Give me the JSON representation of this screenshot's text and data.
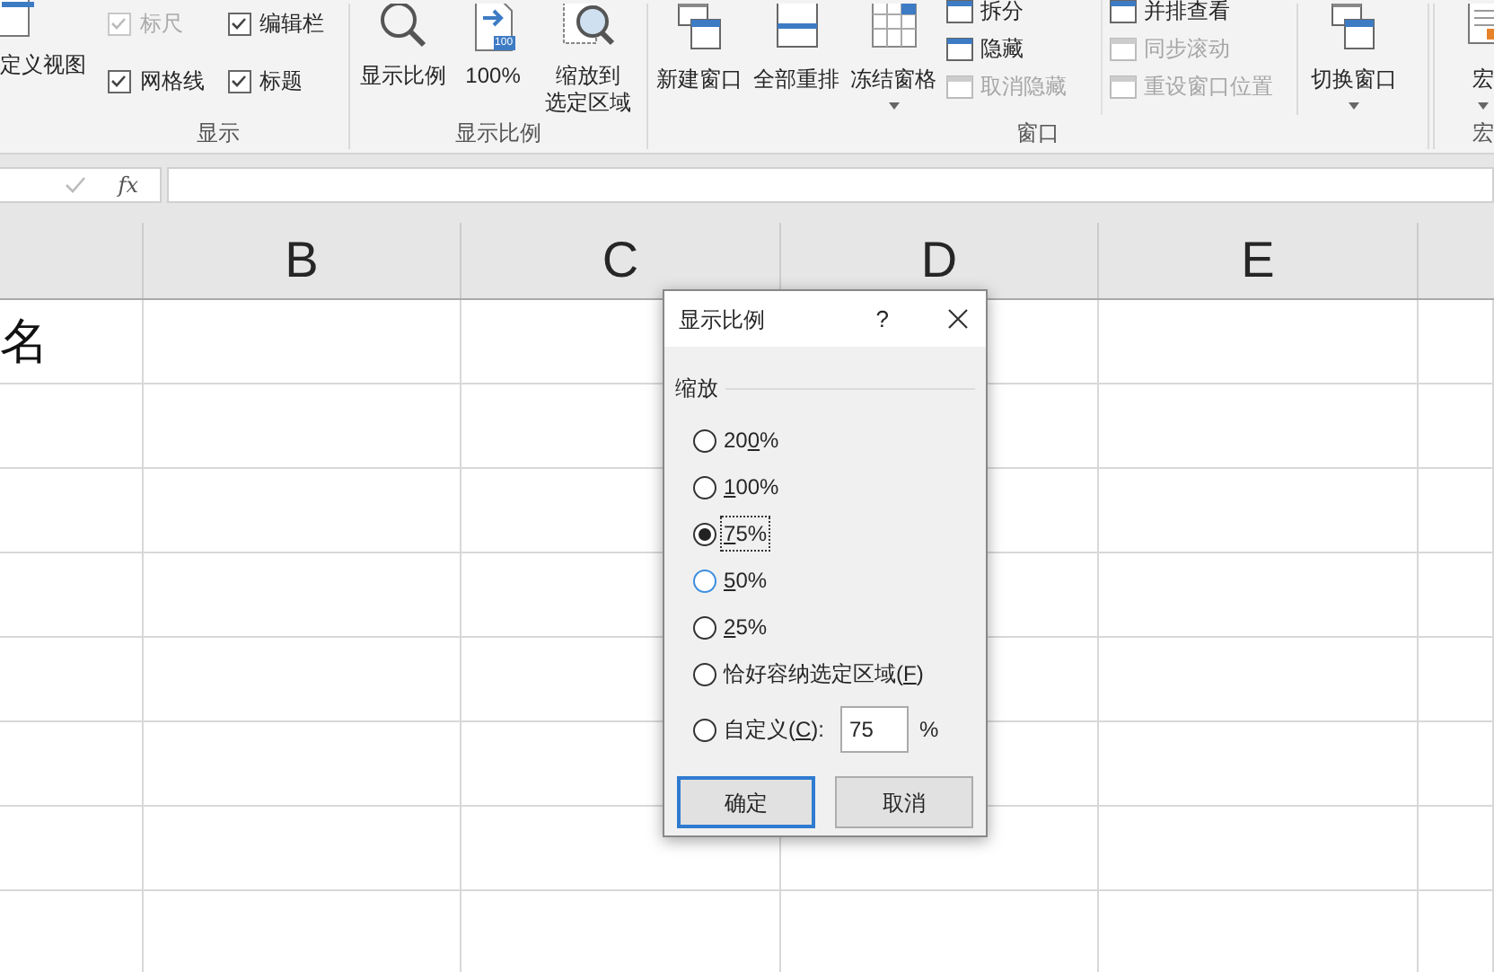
{
  "ribbon": {
    "cut_button": {
      "label": "定义视图"
    },
    "show_group": {
      "label": "显示",
      "checkboxes": [
        {
          "label": "标尺",
          "checked": true,
          "disabled": true
        },
        {
          "label": "编辑栏",
          "checked": true,
          "disabled": false
        },
        {
          "label": "网格线",
          "checked": true,
          "disabled": false
        },
        {
          "label": "标题",
          "checked": true,
          "disabled": false
        }
      ]
    },
    "zoom_group": {
      "label": "显示比例",
      "buttons": [
        {
          "kind": "magnifier",
          "label": "显示比例"
        },
        {
          "kind": "hundred",
          "label": "100%",
          "badge": "100"
        },
        {
          "kind": "selection",
          "label": "缩放到",
          "label_2": "选定区域"
        }
      ]
    },
    "window_group": {
      "label": "窗口",
      "buttons": [
        {
          "kind": "new",
          "label": "新建窗口",
          "caret": false
        },
        {
          "kind": "arrange",
          "label": "全部重排",
          "caret": false
        },
        {
          "kind": "freeze",
          "label": "冻结窗格",
          "caret": true
        }
      ],
      "small_items": [
        {
          "label": "拆分",
          "disabled": false
        },
        {
          "label": "隐藏",
          "disabled": false
        },
        {
          "label": "取消隐藏",
          "disabled": true
        },
        {
          "label": "并排查看",
          "disabled": false
        },
        {
          "label": "同步滚动",
          "disabled": true
        },
        {
          "label": "重设窗口位置",
          "disabled": true
        }
      ],
      "switch_button": {
        "label": "切换窗口",
        "caret": true
      }
    },
    "macro_group": {
      "label": "宏",
      "button": {
        "label": "宏",
        "caret": true
      }
    }
  },
  "formula_bar": {
    "fx": "fx"
  },
  "sheet": {
    "columns": [
      "B",
      "C",
      "D",
      "E"
    ],
    "column_a": [
      "名"
    ]
  },
  "dialog": {
    "title": "显示比例",
    "help": "?",
    "section": "缩放",
    "options": [
      {
        "kind": "radio",
        "before": "20",
        "key": "0",
        "after": "%",
        "selected": false,
        "focused": false,
        "hover": false
      },
      {
        "kind": "radio",
        "key": "1",
        "after": "00%",
        "selected": false,
        "focused": false,
        "hover": false
      },
      {
        "kind": "radio",
        "key": "7",
        "after": "5%",
        "selected": true,
        "focused": true,
        "hover": false
      },
      {
        "kind": "radio",
        "key": "5",
        "after": "0%",
        "selected": false,
        "focused": false,
        "hover": true
      },
      {
        "kind": "radio",
        "key": "2",
        "after": "5%",
        "selected": false,
        "focused": false,
        "hover": false
      },
      {
        "kind": "radio",
        "before": "恰好容纳选定区域(",
        "key": "F",
        "after": ")",
        "selected": false,
        "focused": false,
        "hover": false
      },
      {
        "kind": "custom",
        "before": "自定义(",
        "key": "C",
        "after": "):",
        "selected": false,
        "focused": false,
        "hover": false,
        "value": "75",
        "unit": "%"
      }
    ],
    "buttons": [
      {
        "label": "确定",
        "default": true
      },
      {
        "label": "取消",
        "default": false
      }
    ]
  }
}
